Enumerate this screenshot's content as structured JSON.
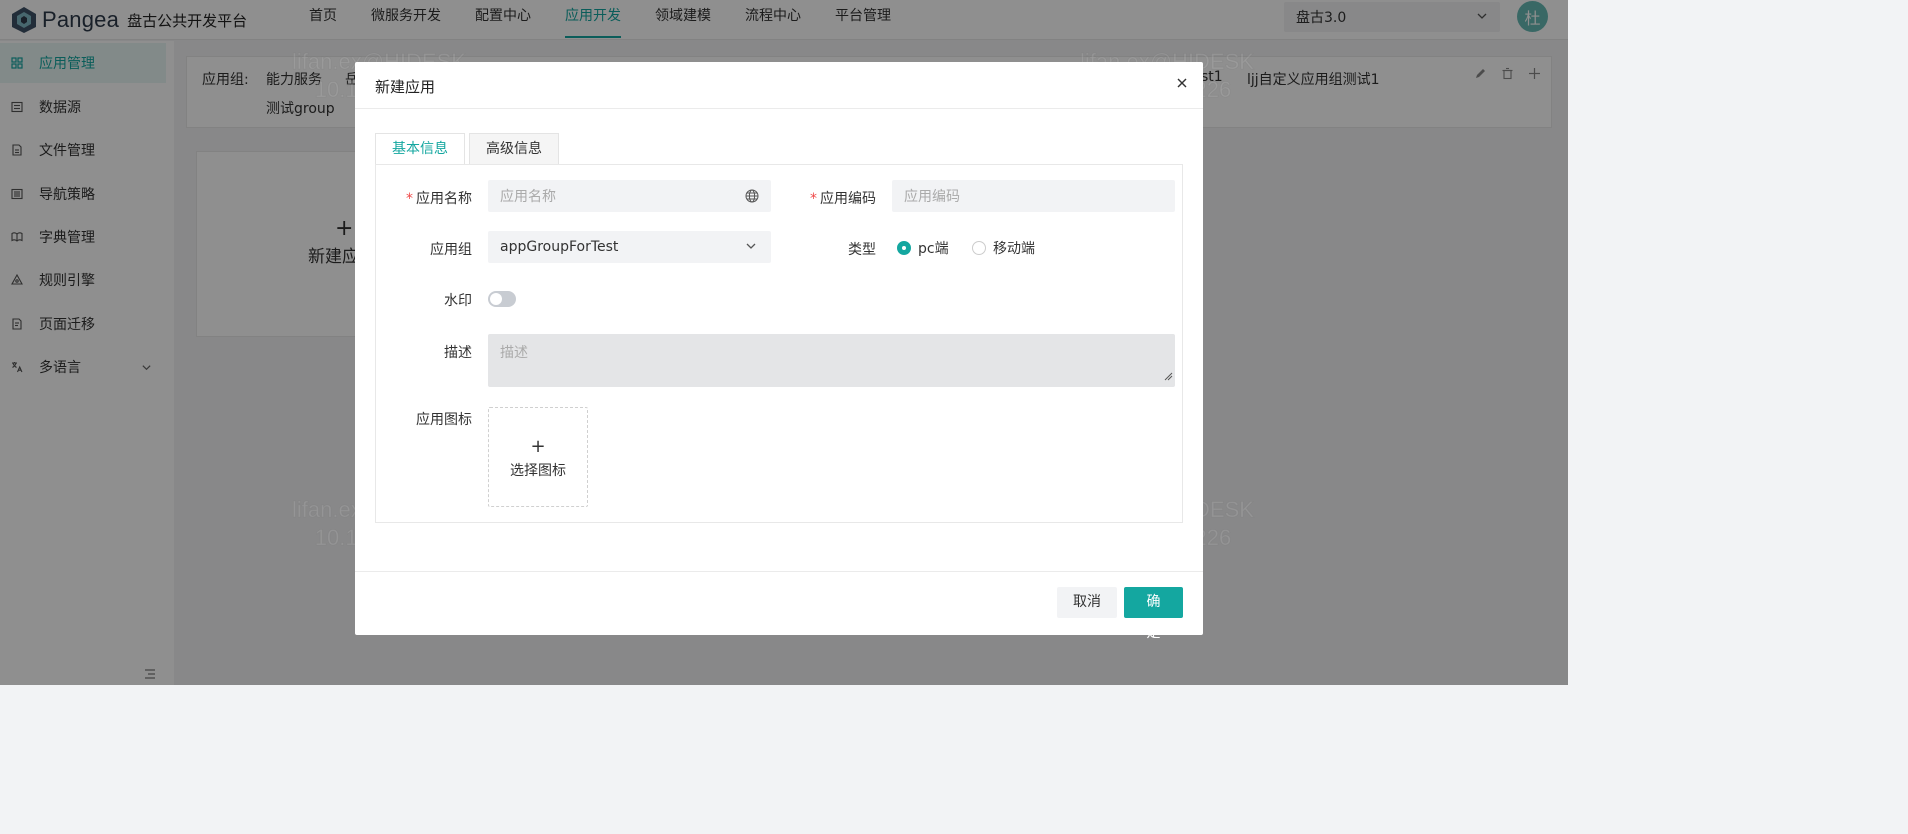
{
  "header": {
    "brand_name": "Pangea",
    "brand_subtitle": "盘古公共开发平台",
    "nav": [
      {
        "label": "首页"
      },
      {
        "label": "微服务开发"
      },
      {
        "label": "配置中心"
      },
      {
        "label": "应用开发",
        "active": true
      },
      {
        "label": "领域建模"
      },
      {
        "label": "流程中心"
      },
      {
        "label": "平台管理"
      }
    ],
    "tenant_value": "盘古3.0",
    "avatar_text": "杜"
  },
  "sidebar": {
    "items": [
      {
        "label": "应用管理",
        "icon": "grid-icon",
        "active": true
      },
      {
        "label": "数据源",
        "icon": "database-icon"
      },
      {
        "label": "文件管理",
        "icon": "file-icon"
      },
      {
        "label": "导航策略",
        "icon": "list-icon"
      },
      {
        "label": "字典管理",
        "icon": "book-icon"
      },
      {
        "label": "规则引擎",
        "icon": "rules-icon"
      },
      {
        "label": "页面迁移",
        "icon": "page-icon"
      },
      {
        "label": "多语言",
        "icon": "translate-icon",
        "expandable": true
      }
    ]
  },
  "main": {
    "group_label": "应用组:",
    "group_tags": [
      "能力服务",
      "岳",
      "st1",
      "ljj自定义应用组测试1",
      "测试group"
    ],
    "new_card_label": "新建应"
  },
  "watermark": {
    "line1": "lifan.ex@HIDESK",
    "line2": "10.19.79.226"
  },
  "modal": {
    "title": "新建应用",
    "tabs": [
      {
        "label": "基本信息",
        "active": true
      },
      {
        "label": "高级信息"
      }
    ],
    "fields": {
      "app_name": {
        "label": "应用名称",
        "placeholder": "应用名称",
        "required": true
      },
      "app_code": {
        "label": "应用编码",
        "placeholder": "应用编码",
        "required": true
      },
      "app_group": {
        "label": "应用组",
        "value": "appGroupForTest"
      },
      "type": {
        "label": "类型",
        "options": [
          "pc端",
          "移动端"
        ],
        "selected": "pc端"
      },
      "watermark": {
        "label": "水印",
        "enabled": false
      },
      "description": {
        "label": "描述",
        "placeholder": "描述"
      },
      "icon": {
        "label": "应用图标",
        "upload_label": "选择图标"
      }
    },
    "buttons": {
      "cancel": "取消",
      "ok": "确定"
    }
  },
  "colors": {
    "accent": "#14a7a0",
    "required": "#f04848"
  }
}
